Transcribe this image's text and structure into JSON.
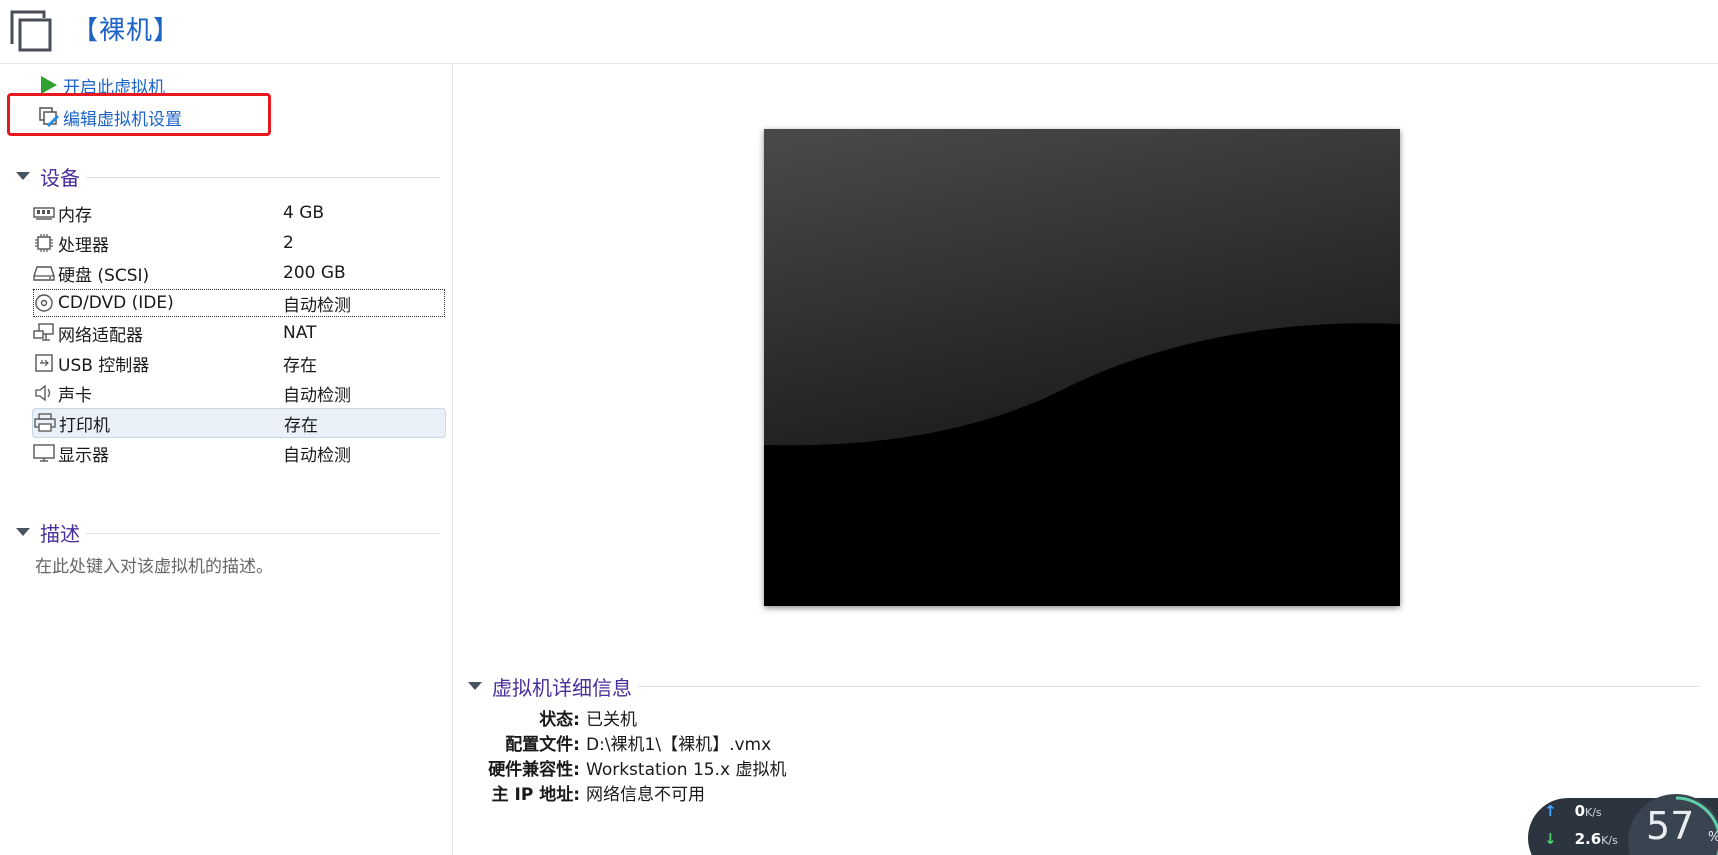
{
  "header": {
    "title": "【裸机】"
  },
  "actions": {
    "start": "开启此虚拟机",
    "edit": "编辑虚拟机设置"
  },
  "devices_section": {
    "title": "设备"
  },
  "devices": [
    {
      "name": "内存",
      "value": "4 GB",
      "icon": "memory-icon"
    },
    {
      "name": "处理器",
      "value": "2",
      "icon": "processor-icon"
    },
    {
      "name": "硬盘 (SCSI)",
      "value": "200 GB",
      "icon": "hard-disk-icon"
    },
    {
      "name": "CD/DVD (IDE)",
      "value": "自动检测",
      "icon": "cd-dvd-icon"
    },
    {
      "name": "网络适配器",
      "value": "NAT",
      "icon": "network-adapter-icon"
    },
    {
      "name": "USB 控制器",
      "value": "存在",
      "icon": "usb-icon"
    },
    {
      "name": "声卡",
      "value": "自动检测",
      "icon": "sound-icon"
    },
    {
      "name": "打印机",
      "value": "存在",
      "icon": "printer-icon"
    },
    {
      "name": "显示器",
      "value": "自动检测",
      "icon": "display-icon"
    }
  ],
  "description_section": {
    "title": "描述",
    "placeholder": "在此处键入对该虚拟机的描述。"
  },
  "details_section": {
    "title": "虚拟机详细信息",
    "rows": [
      {
        "key": "状态:",
        "value": "已关机"
      },
      {
        "key": "配置文件:",
        "value": "D:\\裸机1\\【裸机】.vmx"
      },
      {
        "key": "硬件兼容性:",
        "value": "Workstation 15.x 虚拟机"
      },
      {
        "key": "主 IP 地址:",
        "value": "网络信息不可用"
      }
    ]
  },
  "network_widget": {
    "upload": "0",
    "upload_unit": "K/s",
    "download": "2.6",
    "download_unit": "K/s",
    "usage": "57",
    "usage_unit": "%",
    "usage_fraction": 0.57
  },
  "colors": {
    "link": "#1d63c8",
    "section_title": "#4a2f9c",
    "highlight_box": "#e8191e"
  }
}
